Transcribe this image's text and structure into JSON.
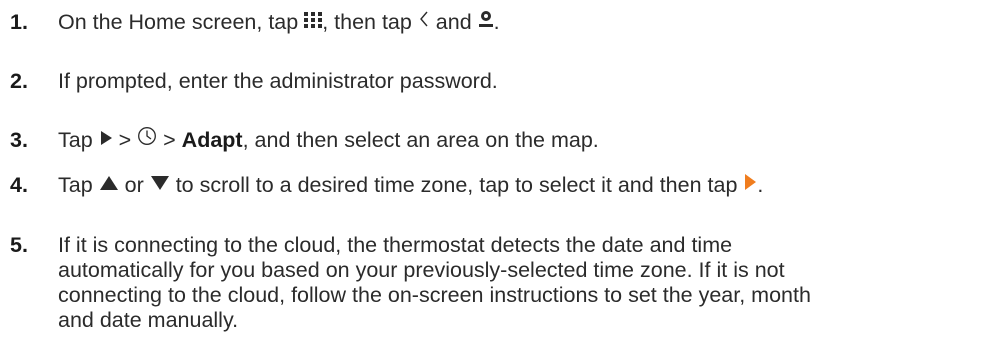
{
  "steps": [
    {
      "number": "1.",
      "part_a": "On the Home screen, tap ",
      "part_b": ", then tap ",
      "part_c": " and ",
      "part_d": ".",
      "icons": [
        "apps-grid-icon",
        "back-chevron-icon",
        "settings-gear-icon"
      ]
    },
    {
      "number": "2.",
      "text": "If prompted, enter the administrator password."
    },
    {
      "number": "3.",
      "part_a": "Tap ",
      "part_b": " > ",
      "part_c": " > ",
      "bold": "Adapt",
      "part_d": ", and then select an area on the map.",
      "icons": [
        "play-arrow-icon",
        "clock-icon"
      ]
    },
    {
      "number": "4.",
      "part_a": "Tap ",
      "part_b": " or ",
      "part_c": " to scroll to a desired time zone, tap to select it and then tap ",
      "part_d": ".",
      "icons": [
        "up-triangle-icon",
        "down-triangle-icon",
        "next-arrow-icon"
      ],
      "accent_color": "#f07d1e"
    },
    {
      "number": "5.",
      "lines": [
        "If it is connecting to the cloud, the thermostat detects the date and time",
        "automatically for you based on your previously-selected time zone. If it is not",
        "connecting to the cloud, follow the on-screen instructions to set the year, month",
        "and date manually."
      ]
    }
  ]
}
